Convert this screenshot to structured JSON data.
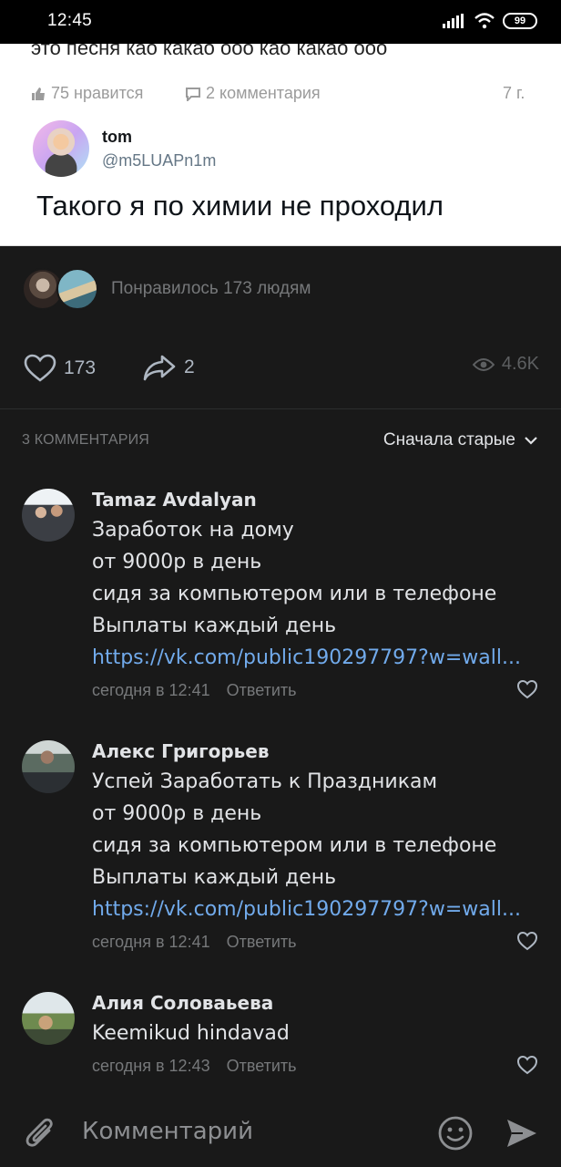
{
  "status_bar": {
    "time": "12:45",
    "battery": "99"
  },
  "embedded_post": {
    "cut_text": "это песня као какао ооо као какао ооо",
    "likes": "75 нравится",
    "comments": "2 комментария",
    "age": "7 г.",
    "author_name": "tom",
    "author_handle": "@m5LUAPn1m",
    "text": "Такого я по химии не проходил"
  },
  "likers": {
    "text": "Понравилось 173 людям"
  },
  "actions": {
    "likes": "173",
    "shares": "2",
    "views": "4.6K"
  },
  "comments_header": {
    "count": "3 КОММЕНТАРИЯ",
    "sort": "Сначала старые"
  },
  "comments": [
    {
      "name": "Tamaz Avdalyan",
      "lines": [
        "Заработок на дому",
        "от 9000р в день",
        "сидя за компьютером или в телефоне",
        "Выплаты каждый день"
      ],
      "link": "https://vk.com/public190297797?w=wall...",
      "time": "сегодня в 12:41",
      "reply": "Ответить"
    },
    {
      "name": "Алекс Григорьев",
      "lines": [
        "Успей Заработать к Праздникам",
        "от 9000р в день",
        "сидя за компьютером или в телефоне",
        "Выплаты каждый день"
      ],
      "link": "https://vk.com/public190297797?w=wall...",
      "time": "сегодня в 12:41",
      "reply": "Ответить"
    },
    {
      "name": "Алия Соловаьева",
      "lines": [
        "Keemikud hindavad"
      ],
      "time": "сегодня в 12:43",
      "reply": "Ответить"
    }
  ],
  "composer": {
    "placeholder": "Комментарий"
  },
  "colors": {
    "background": "#191919",
    "text": "#e1e3e6",
    "muted": "#76787a",
    "link": "#71aaeb"
  }
}
